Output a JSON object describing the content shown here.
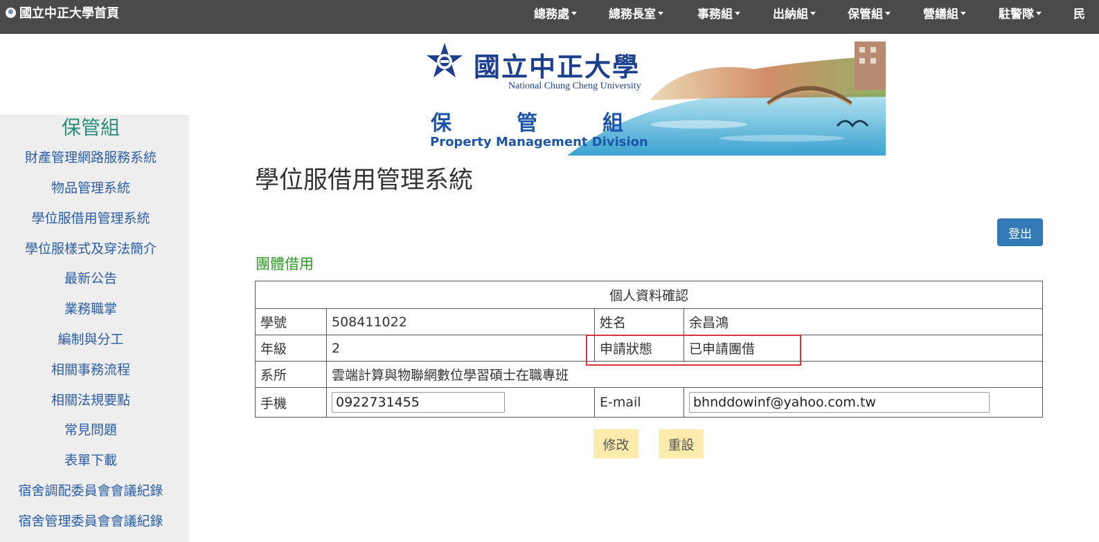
{
  "navbar": {
    "brand": "國立中正大學首頁",
    "items": [
      {
        "label": "總務處"
      },
      {
        "label": "總務長室"
      },
      {
        "label": "事務組"
      },
      {
        "label": "出納組"
      },
      {
        "label": "保管組"
      },
      {
        "label": "營繕組"
      },
      {
        "label": "駐警隊"
      },
      {
        "label": "民"
      }
    ]
  },
  "banner": {
    "university_cn": "國立中正大學",
    "university_en": "National Chung Cheng University",
    "division_cn": "保管組",
    "division_en": "Property Management Division"
  },
  "sidebar": {
    "title": "保管組",
    "items": [
      {
        "label": "財產管理網路服務系統"
      },
      {
        "label": "物品管理系統"
      },
      {
        "label": "學位服借用管理系統"
      },
      {
        "label": "學位服樣式及穿法簡介"
      },
      {
        "label": "最新公告"
      },
      {
        "label": "業務職掌"
      },
      {
        "label": "編制與分工"
      },
      {
        "label": "相關事務流程"
      },
      {
        "label": "相關法規要點"
      },
      {
        "label": "常見問題"
      },
      {
        "label": "表單下載"
      },
      {
        "label": "宿舍調配委員會會議紀錄"
      },
      {
        "label": "宿舍管理委員會會議紀錄"
      }
    ]
  },
  "main": {
    "page_title": "學位服借用管理系統",
    "logout_label": "登出",
    "section_title": "團體借用",
    "table": {
      "caption": "個人資料確認",
      "student_id_label": "學號",
      "student_id": "508411022",
      "name_label": "姓名",
      "name": "余昌鴻",
      "grade_label": "年級",
      "grade": "2",
      "status_label": "申請狀態",
      "status": "已申請團借",
      "dept_label": "系所",
      "dept": "雲端計算與物聯網數位學習碩士在職專班",
      "phone_label": "手機",
      "phone": "0922731455",
      "email_label": "E-mail",
      "email": "bhnddowinf@yahoo.com.tw"
    },
    "modify_label": "修改",
    "reset_label": "重設"
  },
  "colors": {
    "navbar_bg": "#4a4a4a",
    "sidebar_bg": "#eeeeee",
    "sidebar_title": "#2b8e7c",
    "sidebar_link": "#2a5da8",
    "section_title": "#2f9a23",
    "logout_bg": "#337ab7",
    "action_btn_bg": "#fbecad",
    "highlight_border": "#d9333c"
  }
}
